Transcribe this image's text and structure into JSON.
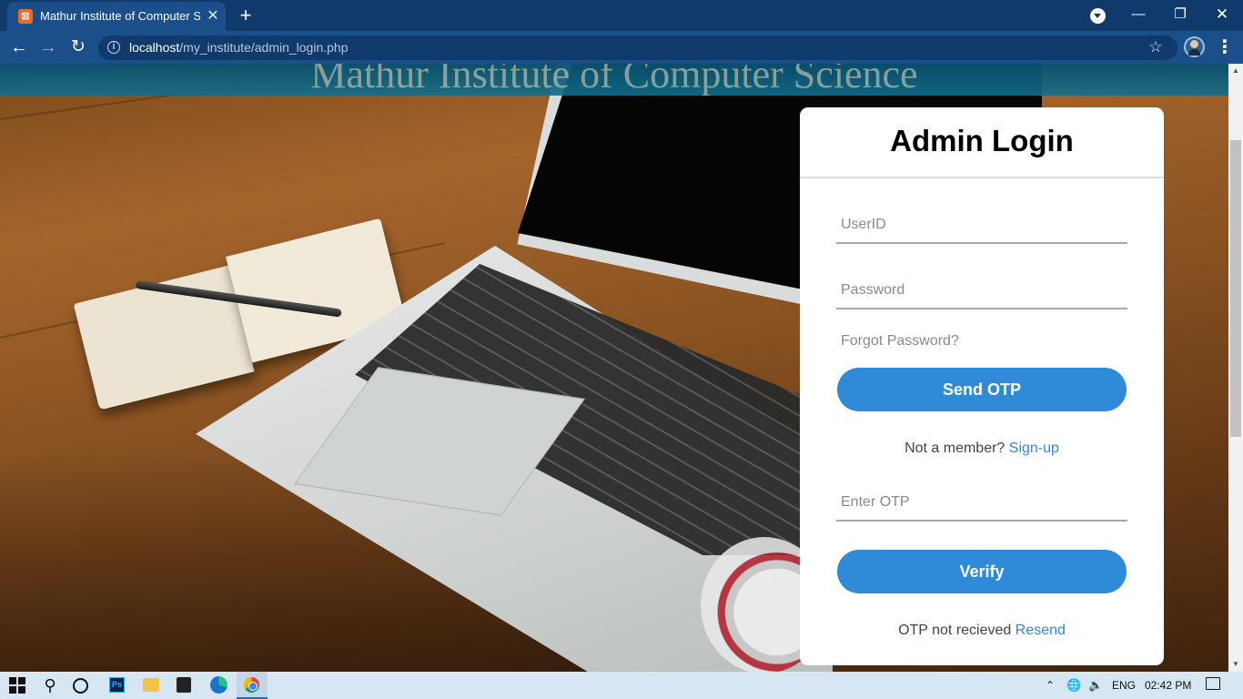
{
  "browser": {
    "tab": {
      "title": "Mathur Institute of Computer Science",
      "close_glyph": "✕"
    },
    "new_tab_glyph": "+",
    "window_controls": {
      "minimize": "—",
      "maximize": "❐",
      "close": "✕"
    },
    "nav": {
      "back": "←",
      "forward": "→",
      "reload": "↻"
    },
    "url": {
      "host": "localhost",
      "path": "/my_institute/admin_login.php"
    },
    "info_glyph": "i",
    "star_glyph": "☆",
    "menu_glyph": "⋮"
  },
  "page": {
    "banner_title": "Mathur Institute of Computer Science",
    "login": {
      "title": "Admin Login",
      "userid_placeholder": "UserID",
      "password_placeholder": "Password",
      "forgot_label": "Forgot Password?",
      "send_otp_label": "Send OTP",
      "member_text": "Not a member?",
      "signup_label": "Sign-up",
      "otp_placeholder": "Enter OTP",
      "verify_label": "Verify",
      "otp_text": "OTP not recieved",
      "resend_label": "Resend"
    },
    "scrollbar": {
      "up_glyph": "▲",
      "down_glyph": "▼",
      "position_fraction": 0.13
    }
  },
  "taskbar": {
    "search_glyph": "⚲",
    "photoshop_label": "Ps",
    "tray": {
      "chevron": "⌃",
      "network_glyph": "🌐",
      "volume_glyph": "🔈",
      "language": "ENG",
      "time": "02:42 PM"
    }
  },
  "colors": {
    "accent": "#2f8ad8",
    "browser_frame": "#0f3a6b",
    "taskbar": "#d7e6f3"
  },
  "icons": [
    "xampp-favicon",
    "close-icon",
    "plus-icon",
    "tab-search-icon",
    "minimize-icon",
    "maximize-icon",
    "back-icon",
    "forward-icon",
    "reload-icon",
    "info-icon",
    "star-icon",
    "profile-avatar",
    "menu-icon",
    "windows-start-icon",
    "search-icon",
    "cortana-icon",
    "photoshop-icon",
    "file-explorer-icon",
    "store-icon",
    "edge-icon",
    "chrome-icon",
    "network-icon",
    "volume-icon",
    "notifications-icon"
  ]
}
